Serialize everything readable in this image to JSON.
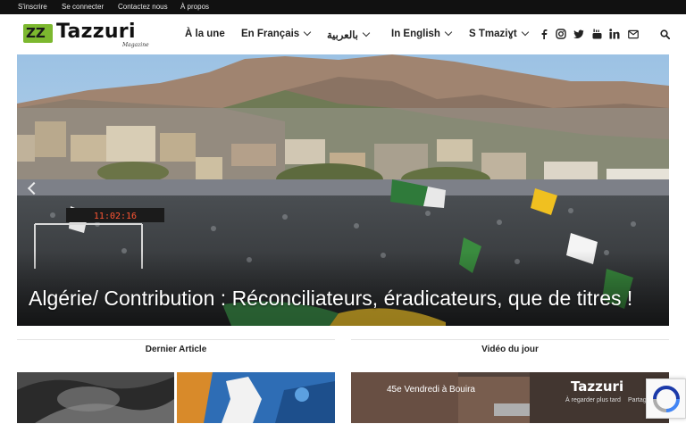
{
  "topbar": {
    "links": [
      "S'inscrire",
      "Se connecter",
      "Contactez nous",
      "À propos"
    ]
  },
  "logo": {
    "mark": "ZZ",
    "name": "Tazzuri",
    "tagline": "Magazine"
  },
  "nav": {
    "items": [
      {
        "label": "À la une",
        "dropdown": false
      },
      {
        "label": "En Français",
        "dropdown": true
      },
      {
        "label": "بالعربية",
        "dropdown": true
      },
      {
        "label": "In English",
        "dropdown": true
      },
      {
        "label": "S Tmaziɣt",
        "dropdown": true
      }
    ],
    "social_icons": [
      "facebook-icon",
      "instagram-icon",
      "twitter-icon",
      "youtube-icon",
      "linkedin-icon",
      "mail-icon"
    ],
    "search_icon": "search-icon"
  },
  "hero": {
    "title": "Algérie/ Contribution : Réconciliateurs, éradicateurs, que de titres !",
    "scoreboard": "11:02:16"
  },
  "sections": {
    "latest": "Dernier Article",
    "video": "Vidéo du jour"
  },
  "video": {
    "title": "45e Vendredi à Bouira",
    "channel": "Tazzuri",
    "watch_later": "À regarder plus tard",
    "share": "Partager"
  },
  "colors": {
    "topbar": "#111111",
    "brand_green": "#7cb82f",
    "text": "#222222"
  }
}
